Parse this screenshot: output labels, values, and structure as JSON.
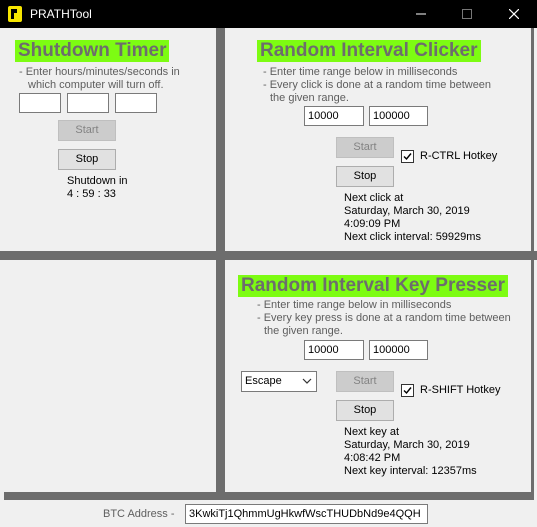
{
  "window": {
    "title": "PRATHTool",
    "minimize": "—",
    "maximize": "☐",
    "close": "✕"
  },
  "shutdown": {
    "heading": "Shutdown Timer",
    "desc_line1": "- Enter hours/minutes/seconds in",
    "desc_line2": "which computer will turn off.",
    "hours": "",
    "minutes": "",
    "seconds": "",
    "start_label": "Start",
    "stop_label": "Stop",
    "status_line1": "Shutdown in",
    "status_line2": "4 : 59 : 33"
  },
  "clicker": {
    "heading": "Random Interval Clicker",
    "desc_line1": "- Enter time range below in milliseconds",
    "desc_line2": "- Every click is done at a random time between",
    "desc_line3": "the given range.",
    "min_value": "10000",
    "max_value": "100000",
    "start_label": "Start",
    "stop_label": "Stop",
    "hotkey_label": "R-CTRL Hotkey",
    "hotkey_checked": true,
    "next_line1": "Next click at",
    "next_line2": "Saturday, March 30, 2019",
    "next_line3": "4:09:09 PM",
    "next_line4": "Next click interval: 59929ms"
  },
  "presser": {
    "heading": "Random Interval Key Presser",
    "desc_line1": "- Enter time range below in milliseconds",
    "desc_line2": "- Every key press is done at a random time between",
    "desc_line3": "the given range.",
    "min_value": "10000",
    "max_value": "100000",
    "key_selected": "Escape",
    "start_label": "Start",
    "stop_label": "Stop",
    "hotkey_label": "R-SHIFT Hotkey",
    "hotkey_checked": true,
    "next_line1": "Next key at",
    "next_line2": "Saturday, March 30, 2019",
    "next_line3": "4:08:42 PM",
    "next_line4": "Next key interval: 12357ms"
  },
  "footer": {
    "btc_label": "BTC Address -",
    "btc_value": "3KwkiTj1QhmmUgHkwfWscTHUDbNd9e4QQH"
  },
  "icons": {
    "app": "app-logo-icon",
    "dropdown": "chevron-down-icon",
    "check": "checkmark-icon"
  },
  "colors": {
    "heading_bg": "#7dfc12",
    "heading_text": "#6d6d6d",
    "divider": "#6d6d6d",
    "titlebar": "#000000"
  }
}
